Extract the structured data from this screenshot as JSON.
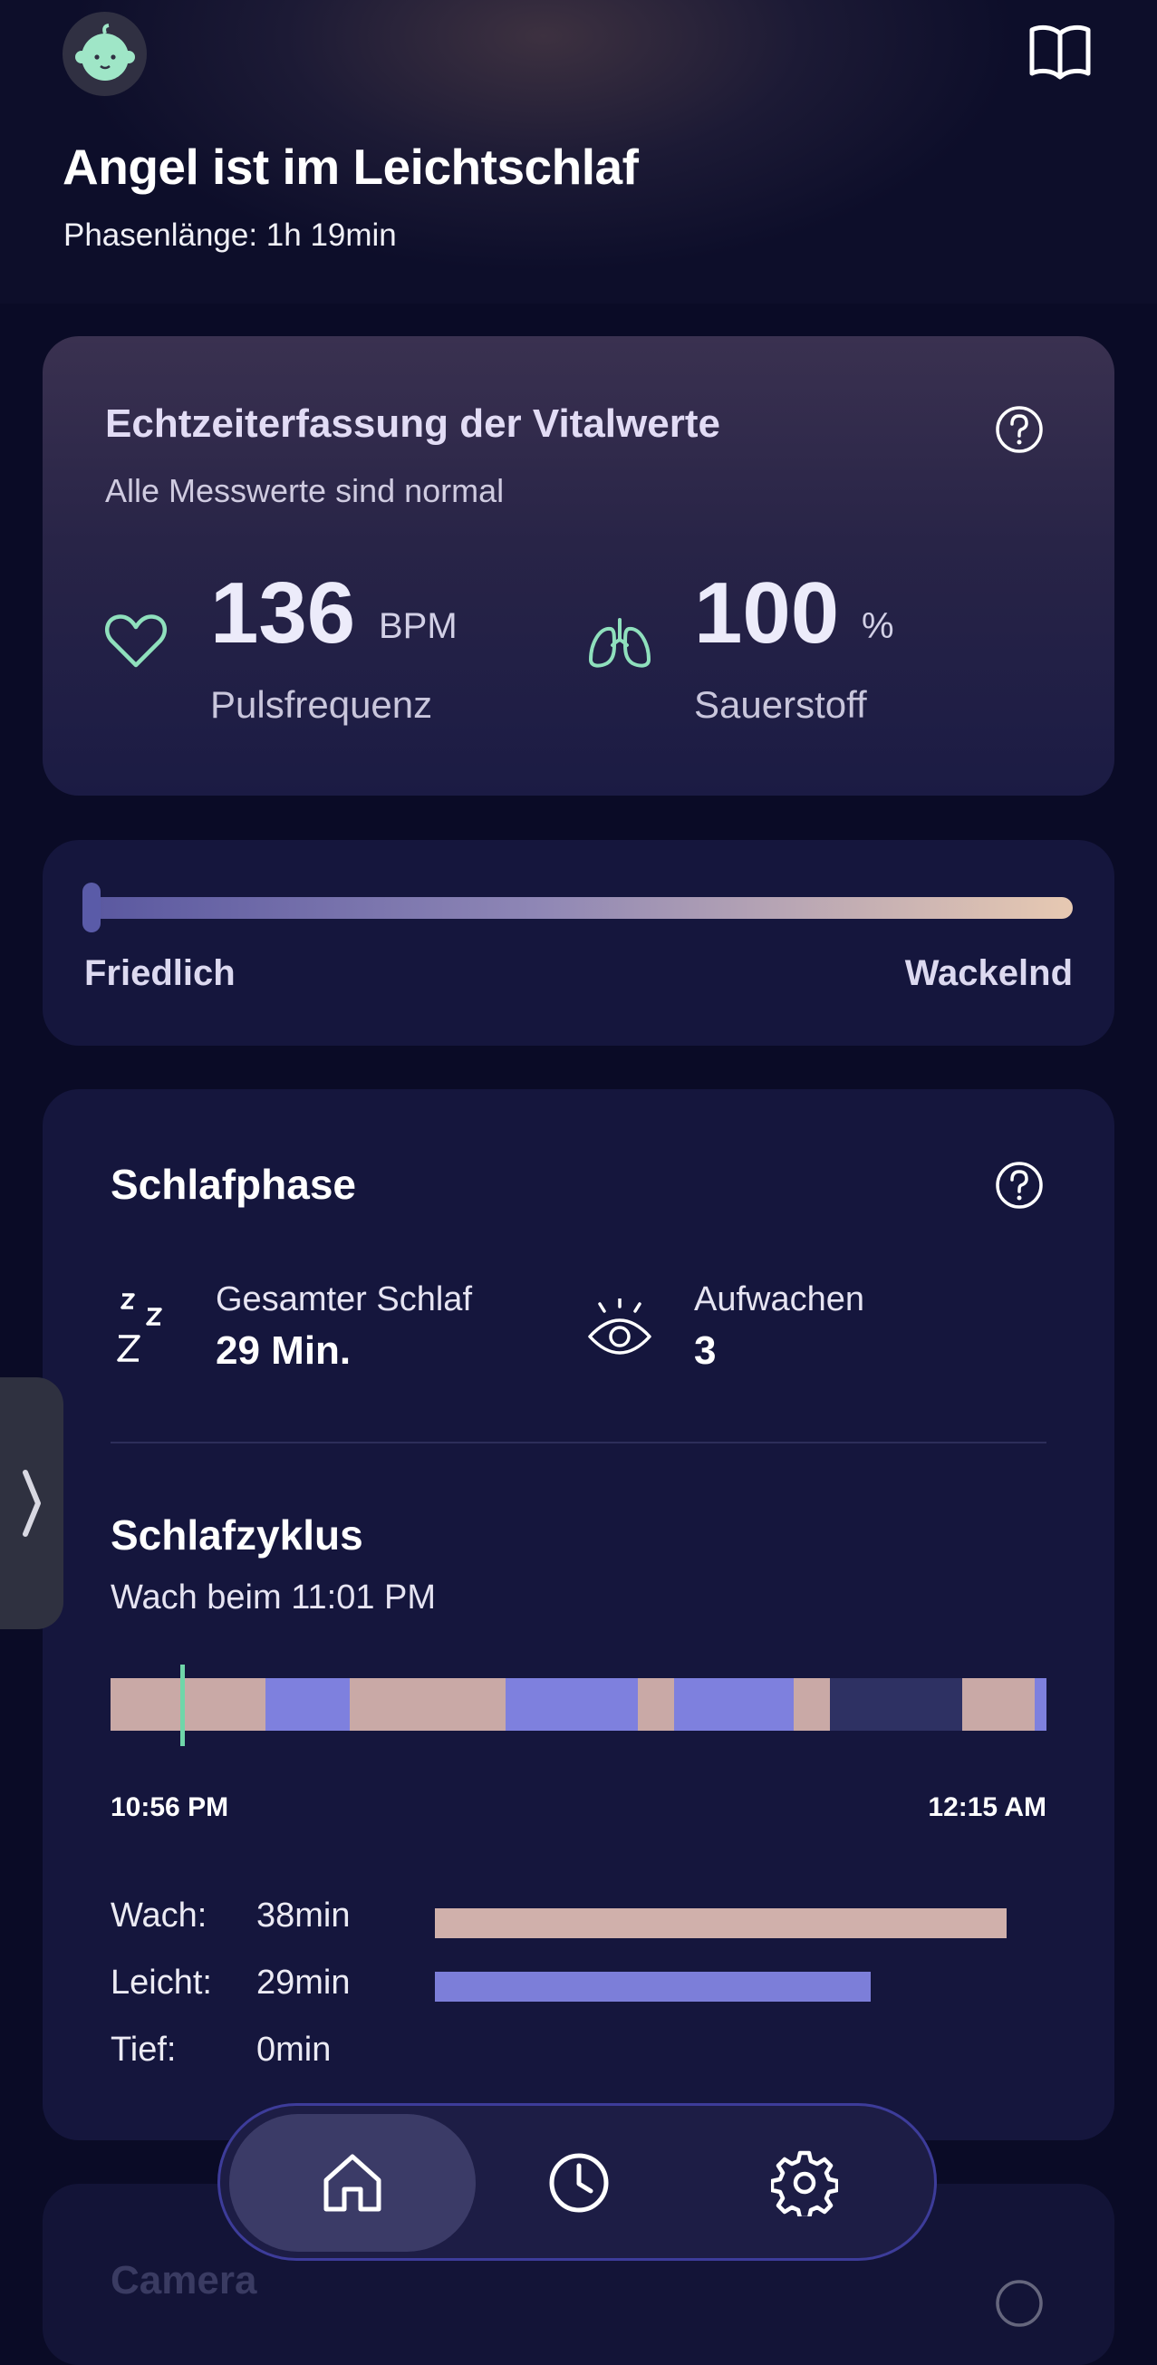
{
  "header": {
    "title": "Angel ist im Leichtschlaf",
    "subtitle": "Phasenlänge: 1h 19min",
    "avatar_icon": "baby-face-icon",
    "guide_icon": "book-icon"
  },
  "vitals": {
    "title": "Echtzeiterfassung der Vitalwerte",
    "subtitle": "Alle Messwerte sind normal",
    "pulse": {
      "value": "136",
      "unit": "BPM",
      "label": "Pulsfrequenz",
      "icon": "heart-icon"
    },
    "oxygen": {
      "value": "100",
      "unit": "%",
      "label": "Sauerstoff",
      "icon": "lungs-icon"
    },
    "accent_color": "#8fe0bd"
  },
  "movement": {
    "left_label": "Friedlich",
    "right_label": "Wackelnd",
    "level": 0.0
  },
  "sleep": {
    "title": "Schlafphase",
    "total": {
      "label": "Gesamter Schlaf",
      "value": "29 Min.",
      "icon": "zzz-icon"
    },
    "wakeups": {
      "label": "Aufwachen",
      "value": "3",
      "icon": "eye-icon"
    },
    "cycle": {
      "title": "Schlafzyklus",
      "subtitle": "Wach beim 11:01 PM",
      "start": "10:56 PM",
      "end": "12:15 AM",
      "segments": [
        {
          "stage": "wach",
          "fraction": 0.166
        },
        {
          "stage": "leicht",
          "fraction": 0.09
        },
        {
          "stage": "wach",
          "fraction": 0.166
        },
        {
          "stage": "leicht",
          "fraction": 0.141
        },
        {
          "stage": "wach",
          "fraction": 0.039
        },
        {
          "stage": "leicht",
          "fraction": 0.128
        },
        {
          "stage": "wach",
          "fraction": 0.039
        },
        {
          "stage": "unbekannt",
          "fraction": 0.141
        },
        {
          "stage": "wach",
          "fraction": 0.077
        },
        {
          "stage": "leicht",
          "fraction": 0.013
        }
      ],
      "cursor_fraction": 0.077
    },
    "legend": [
      {
        "label": "Wach:",
        "value": "38min",
        "fraction": 0.97,
        "color": "#d0b0ab"
      },
      {
        "label": "Leicht:",
        "value": "29min",
        "fraction": 0.74,
        "color": "#7c7ed9"
      },
      {
        "label": "Tief:",
        "value": "0min",
        "fraction": 0.0,
        "color": "#4a4da8"
      }
    ],
    "colors": {
      "wach": "#c9a9a6",
      "leicht": "#7e80de",
      "unbekannt": "#2e3163"
    }
  },
  "camera": {
    "title": "Camera"
  },
  "nav": {
    "items": [
      {
        "name": "home",
        "icon": "home-icon",
        "active": true
      },
      {
        "name": "history",
        "icon": "clock-icon",
        "active": false
      },
      {
        "name": "settings",
        "icon": "gear-icon",
        "active": false
      }
    ]
  }
}
